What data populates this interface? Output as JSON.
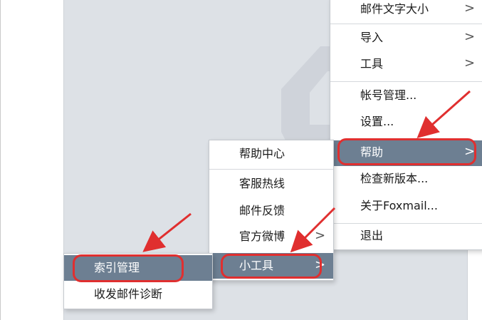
{
  "main_menu": {
    "items": [
      {
        "label": "邮件文字大小",
        "has_submenu": true
      },
      {
        "label": "导入",
        "has_submenu": true
      },
      {
        "label": "工具",
        "has_submenu": true
      },
      {
        "label": "帐号管理...",
        "has_submenu": false
      },
      {
        "label": "设置...",
        "has_submenu": false
      },
      {
        "label": "帮助",
        "has_submenu": true,
        "active": true
      },
      {
        "label": "检查新版本...",
        "has_submenu": false
      },
      {
        "label": "关于Foxmail...",
        "has_submenu": false
      },
      {
        "label": "退出",
        "has_submenu": false
      }
    ]
  },
  "help_menu": {
    "items": [
      {
        "label": "帮助中心",
        "has_submenu": false
      },
      {
        "label": "客服热线",
        "has_submenu": false
      },
      {
        "label": "邮件反馈",
        "has_submenu": false
      },
      {
        "label": "官方微博",
        "has_submenu": true
      },
      {
        "label": "小工具",
        "has_submenu": true,
        "active": true
      }
    ]
  },
  "tools_menu": {
    "items": [
      {
        "label": "索引管理",
        "active": true
      },
      {
        "label": "收发邮件诊断",
        "active": false
      }
    ]
  },
  "submenu_arrow": ">",
  "colors": {
    "active_item_bg": "#6d7f92",
    "annotation_red": "#e02f2f",
    "workspace_bg": "#dde1e6"
  },
  "icons": [
    "foxmail-logo-watermark",
    "chevron-right-icon",
    "annotation-arrow"
  ]
}
